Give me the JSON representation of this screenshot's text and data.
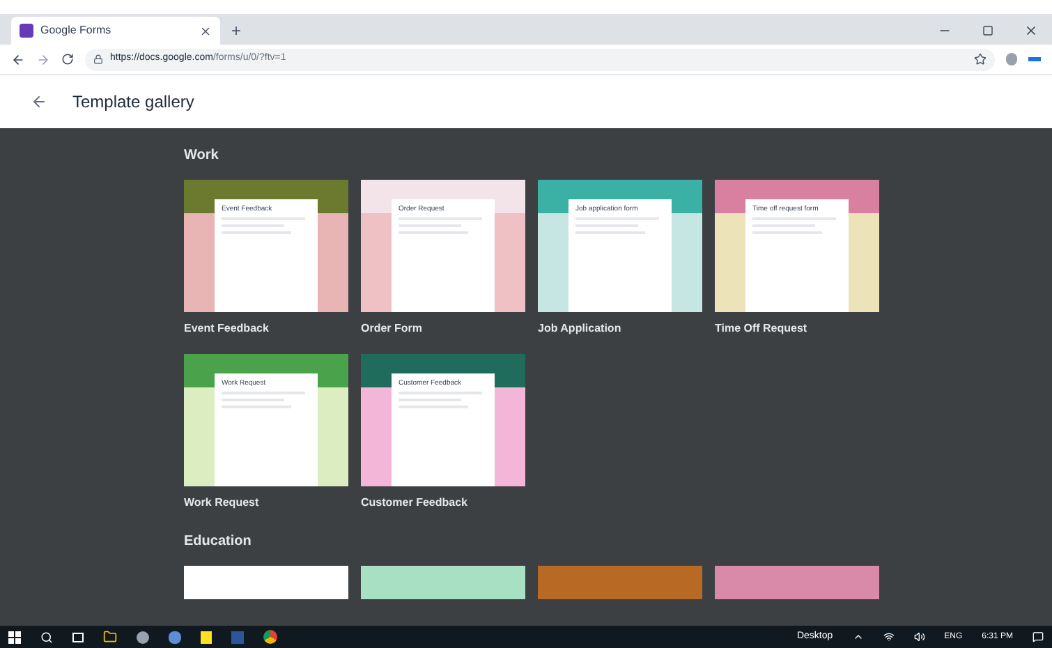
{
  "browser": {
    "tab_title": "Google Forms",
    "new_tab": "+",
    "url_host": "https://docs.google.com",
    "url_path": "/forms/u/0/?ftv=1"
  },
  "header": {
    "title": "Template gallery"
  },
  "sections": [
    {
      "title": "Work",
      "templates": [
        {
          "kind": "full",
          "name": "Event Feedback",
          "preview_title": "Event Feedback"
        },
        {
          "kind": "full",
          "name": "Order Form",
          "preview_title": "Order Request"
        },
        {
          "kind": "full",
          "name": "Job Application",
          "preview_title": "Job application form"
        },
        {
          "kind": "full",
          "name": "Time Off Request",
          "preview_title": "Time off request form"
        },
        {
          "kind": "full",
          "name": "Work Request",
          "preview_title": "Work Request"
        },
        {
          "kind": "full",
          "name": "Customer Feedback",
          "preview_title": "Customer Feedback"
        }
      ]
    },
    {
      "title": "Education",
      "templates": [
        {
          "kind": "cut"
        },
        {
          "kind": "cut"
        },
        {
          "kind": "cut"
        },
        {
          "kind": "cut"
        }
      ]
    }
  ],
  "taskbar": {
    "desktop": "Desktop",
    "language": "ENG",
    "time": "6:31 PM"
  }
}
